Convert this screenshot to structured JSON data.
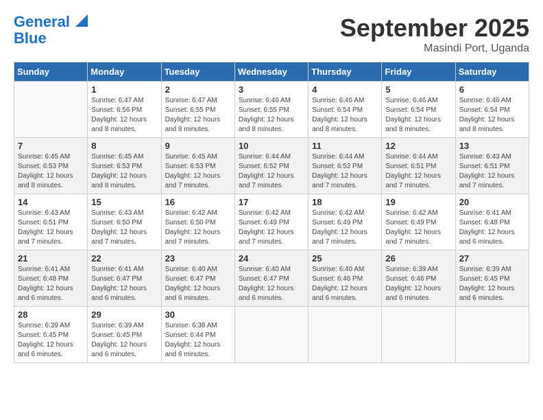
{
  "logo": {
    "line1": "General",
    "line2": "Blue"
  },
  "title": "September 2025",
  "location": "Masindi Port, Uganda",
  "days_header": [
    "Sunday",
    "Monday",
    "Tuesday",
    "Wednesday",
    "Thursday",
    "Friday",
    "Saturday"
  ],
  "weeks": [
    [
      {
        "day": "",
        "sunrise": "",
        "sunset": "",
        "daylight": ""
      },
      {
        "day": "1",
        "sunrise": "Sunrise: 6:47 AM",
        "sunset": "Sunset: 6:56 PM",
        "daylight": "Daylight: 12 hours and 8 minutes."
      },
      {
        "day": "2",
        "sunrise": "Sunrise: 6:47 AM",
        "sunset": "Sunset: 6:55 PM",
        "daylight": "Daylight: 12 hours and 8 minutes."
      },
      {
        "day": "3",
        "sunrise": "Sunrise: 6:46 AM",
        "sunset": "Sunset: 6:55 PM",
        "daylight": "Daylight: 12 hours and 8 minutes."
      },
      {
        "day": "4",
        "sunrise": "Sunrise: 6:46 AM",
        "sunset": "Sunset: 6:54 PM",
        "daylight": "Daylight: 12 hours and 8 minutes."
      },
      {
        "day": "5",
        "sunrise": "Sunrise: 6:46 AM",
        "sunset": "Sunset: 6:54 PM",
        "daylight": "Daylight: 12 hours and 8 minutes."
      },
      {
        "day": "6",
        "sunrise": "Sunrise: 6:46 AM",
        "sunset": "Sunset: 6:54 PM",
        "daylight": "Daylight: 12 hours and 8 minutes."
      }
    ],
    [
      {
        "day": "7",
        "sunrise": "Sunrise: 6:45 AM",
        "sunset": "Sunset: 6:53 PM",
        "daylight": "Daylight: 12 hours and 8 minutes."
      },
      {
        "day": "8",
        "sunrise": "Sunrise: 6:45 AM",
        "sunset": "Sunset: 6:53 PM",
        "daylight": "Daylight: 12 hours and 8 minutes."
      },
      {
        "day": "9",
        "sunrise": "Sunrise: 6:45 AM",
        "sunset": "Sunset: 6:53 PM",
        "daylight": "Daylight: 12 hours and 7 minutes."
      },
      {
        "day": "10",
        "sunrise": "Sunrise: 6:44 AM",
        "sunset": "Sunset: 6:52 PM",
        "daylight": "Daylight: 12 hours and 7 minutes."
      },
      {
        "day": "11",
        "sunrise": "Sunrise: 6:44 AM",
        "sunset": "Sunset: 6:52 PM",
        "daylight": "Daylight: 12 hours and 7 minutes."
      },
      {
        "day": "12",
        "sunrise": "Sunrise: 6:44 AM",
        "sunset": "Sunset: 6:51 PM",
        "daylight": "Daylight: 12 hours and 7 minutes."
      },
      {
        "day": "13",
        "sunrise": "Sunrise: 6:43 AM",
        "sunset": "Sunset: 6:51 PM",
        "daylight": "Daylight: 12 hours and 7 minutes."
      }
    ],
    [
      {
        "day": "14",
        "sunrise": "Sunrise: 6:43 AM",
        "sunset": "Sunset: 6:51 PM",
        "daylight": "Daylight: 12 hours and 7 minutes."
      },
      {
        "day": "15",
        "sunrise": "Sunrise: 6:43 AM",
        "sunset": "Sunset: 6:50 PM",
        "daylight": "Daylight: 12 hours and 7 minutes."
      },
      {
        "day": "16",
        "sunrise": "Sunrise: 6:42 AM",
        "sunset": "Sunset: 6:50 PM",
        "daylight": "Daylight: 12 hours and 7 minutes."
      },
      {
        "day": "17",
        "sunrise": "Sunrise: 6:42 AM",
        "sunset": "Sunset: 6:49 PM",
        "daylight": "Daylight: 12 hours and 7 minutes."
      },
      {
        "day": "18",
        "sunrise": "Sunrise: 6:42 AM",
        "sunset": "Sunset: 6:49 PM",
        "daylight": "Daylight: 12 hours and 7 minutes."
      },
      {
        "day": "19",
        "sunrise": "Sunrise: 6:42 AM",
        "sunset": "Sunset: 6:49 PM",
        "daylight": "Daylight: 12 hours and 7 minutes."
      },
      {
        "day": "20",
        "sunrise": "Sunrise: 6:41 AM",
        "sunset": "Sunset: 6:48 PM",
        "daylight": "Daylight: 12 hours and 6 minutes."
      }
    ],
    [
      {
        "day": "21",
        "sunrise": "Sunrise: 6:41 AM",
        "sunset": "Sunset: 6:48 PM",
        "daylight": "Daylight: 12 hours and 6 minutes."
      },
      {
        "day": "22",
        "sunrise": "Sunrise: 6:41 AM",
        "sunset": "Sunset: 6:47 PM",
        "daylight": "Daylight: 12 hours and 6 minutes."
      },
      {
        "day": "23",
        "sunrise": "Sunrise: 6:40 AM",
        "sunset": "Sunset: 6:47 PM",
        "daylight": "Daylight: 12 hours and 6 minutes."
      },
      {
        "day": "24",
        "sunrise": "Sunrise: 6:40 AM",
        "sunset": "Sunset: 6:47 PM",
        "daylight": "Daylight: 12 hours and 6 minutes."
      },
      {
        "day": "25",
        "sunrise": "Sunrise: 6:40 AM",
        "sunset": "Sunset: 6:46 PM",
        "daylight": "Daylight: 12 hours and 6 minutes."
      },
      {
        "day": "26",
        "sunrise": "Sunrise: 6:39 AM",
        "sunset": "Sunset: 6:46 PM",
        "daylight": "Daylight: 12 hours and 6 minutes."
      },
      {
        "day": "27",
        "sunrise": "Sunrise: 6:39 AM",
        "sunset": "Sunset: 6:45 PM",
        "daylight": "Daylight: 12 hours and 6 minutes."
      }
    ],
    [
      {
        "day": "28",
        "sunrise": "Sunrise: 6:39 AM",
        "sunset": "Sunset: 6:45 PM",
        "daylight": "Daylight: 12 hours and 6 minutes."
      },
      {
        "day": "29",
        "sunrise": "Sunrise: 6:39 AM",
        "sunset": "Sunset: 6:45 PM",
        "daylight": "Daylight: 12 hours and 6 minutes."
      },
      {
        "day": "30",
        "sunrise": "Sunrise: 6:38 AM",
        "sunset": "Sunset: 6:44 PM",
        "daylight": "Daylight: 12 hours and 6 minutes."
      },
      {
        "day": "",
        "sunrise": "",
        "sunset": "",
        "daylight": ""
      },
      {
        "day": "",
        "sunrise": "",
        "sunset": "",
        "daylight": ""
      },
      {
        "day": "",
        "sunrise": "",
        "sunset": "",
        "daylight": ""
      },
      {
        "day": "",
        "sunrise": "",
        "sunset": "",
        "daylight": ""
      }
    ]
  ]
}
